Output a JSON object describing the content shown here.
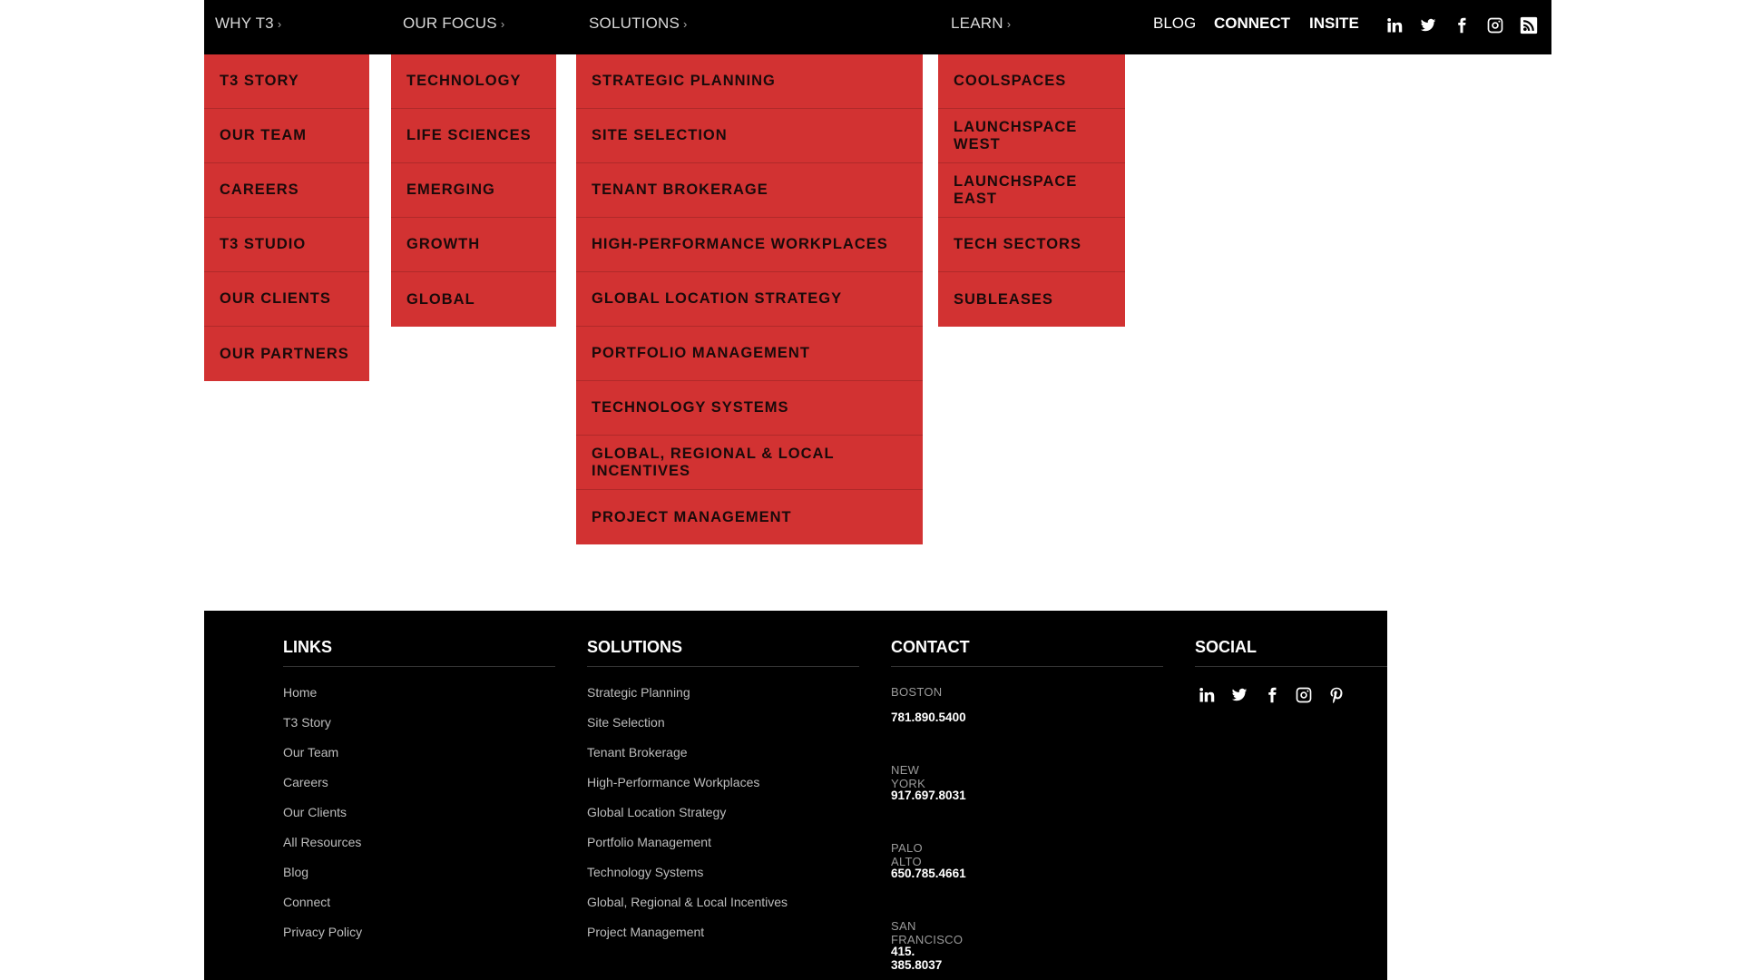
{
  "header": {
    "nav": [
      {
        "label": "WHY T3"
      },
      {
        "label": "OUR FOCUS"
      },
      {
        "label": "SOLUTIONS"
      },
      {
        "label": "LEARN"
      }
    ],
    "chevron": "›",
    "right_links": [
      {
        "label": "BLOG"
      },
      {
        "label": "CONNECT"
      },
      {
        "label": "INSITE"
      }
    ],
    "social_icons": [
      "linkedin-icon",
      "twitter-icon",
      "facebook-icon",
      "instagram-icon",
      "rss-icon"
    ]
  },
  "menus": {
    "why_t3": [
      "T3 STORY",
      "OUR TEAM",
      "CAREERS",
      "T3 STUDIO",
      "OUR CLIENTS",
      "OUR PARTNERS"
    ],
    "our_focus": [
      "TECHNOLOGY",
      "LIFE SCIENCES",
      "EMERGING",
      "GROWTH",
      "GLOBAL"
    ],
    "solutions": [
      "STRATEGIC PLANNING",
      "SITE SELECTION",
      "TENANT BROKERAGE",
      "HIGH-PERFORMANCE WORKPLACES",
      "GLOBAL LOCATION STRATEGY",
      "PORTFOLIO MANAGEMENT",
      "TECHNOLOGY SYSTEMS",
      "GLOBAL, REGIONAL & LOCAL INCENTIVES",
      "PROJECT MANAGEMENT"
    ],
    "learn": [
      "COOLSPACES",
      "LAUNCHSPACE WEST",
      "LAUNCHSPACE EAST",
      "TECH SECTORS",
      "SUBLEASES"
    ]
  },
  "footer": {
    "links": {
      "title": "LINKS",
      "items": [
        "Home",
        "T3 Story",
        "Our Team",
        "Careers",
        "Our Clients",
        "All Resources",
        "Blog",
        "Connect",
        "Privacy Policy"
      ]
    },
    "solutions": {
      "title": "SOLUTIONS",
      "items": [
        "Strategic Planning",
        "Site Selection",
        "Tenant Brokerage",
        "High-Performance Workplaces",
        "Global Location Strategy",
        "Portfolio Management",
        "Technology Systems",
        "Global, Regional & Local Incentives",
        "Project Management"
      ]
    },
    "contact": {
      "title": "CONTACT",
      "offices": [
        {
          "city": "BOSTON",
          "phone": "781.890.5400"
        },
        {
          "city": "NEW YORK",
          "phone": "917.697.8031"
        },
        {
          "city": "PALO ALTO",
          "phone": "650.785.4661"
        },
        {
          "city": "SAN FRANCISCO",
          "phone": "415. 385.8037"
        }
      ]
    },
    "social": {
      "title": "SOCIAL",
      "icons": [
        "linkedin-icon",
        "twitter-icon",
        "facebook-icon",
        "instagram-icon",
        "pinterest-icon"
      ]
    }
  },
  "colors": {
    "menu_red": "#d23232",
    "bar_black": "#000000",
    "page_bg": "#ffffff"
  }
}
